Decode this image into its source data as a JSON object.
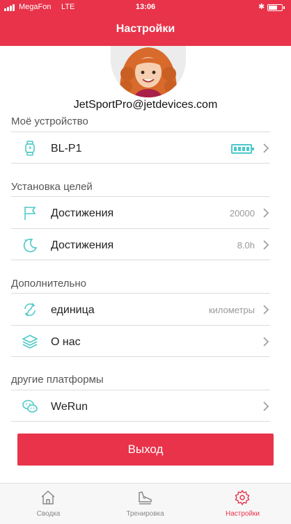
{
  "status_bar": {
    "carrier": "MegaFon",
    "network": "LTE",
    "time": "13:06",
    "bluetooth_icon": "bluetooth-icon",
    "battery_level": 0.6
  },
  "header": {
    "title": "Настройки"
  },
  "profile": {
    "email": "JetSportPro@jetdevices.com",
    "avatar_icon": "avatar-girl"
  },
  "sections": {
    "device": {
      "title": "Моё устройство",
      "device_name": "BL-P1",
      "device_icon": "watch-icon",
      "battery_icon": "battery-icon",
      "battery_level": 1.0
    },
    "goals": {
      "title": "Установка целей",
      "steps_label": "Достижения",
      "steps_value": "20000",
      "steps_icon": "flag-icon",
      "sleep_label": "Достижения",
      "sleep_value": "8.0h",
      "sleep_icon": "moon-icon"
    },
    "extra": {
      "title": "Дополнительно",
      "unit_label": "единица",
      "unit_value": "километры",
      "unit_icon": "sync-icon",
      "about_label": "О нас",
      "about_icon": "layers-icon"
    },
    "platforms": {
      "title": "другие платформы",
      "werun_label": "WeRun",
      "werun_icon": "wechat-icon"
    }
  },
  "logout_label": "Выход",
  "tabs": [
    {
      "label": "Сводка",
      "icon": "home-icon",
      "active": false
    },
    {
      "label": "Тренировка",
      "icon": "shoe-icon",
      "active": false
    },
    {
      "label": "Настройки",
      "icon": "gear-icon",
      "active": true
    }
  ],
  "colors": {
    "accent": "#e8334a",
    "icon_teal": "#4ec8c8",
    "text": "#222222",
    "muted": "#999999"
  }
}
